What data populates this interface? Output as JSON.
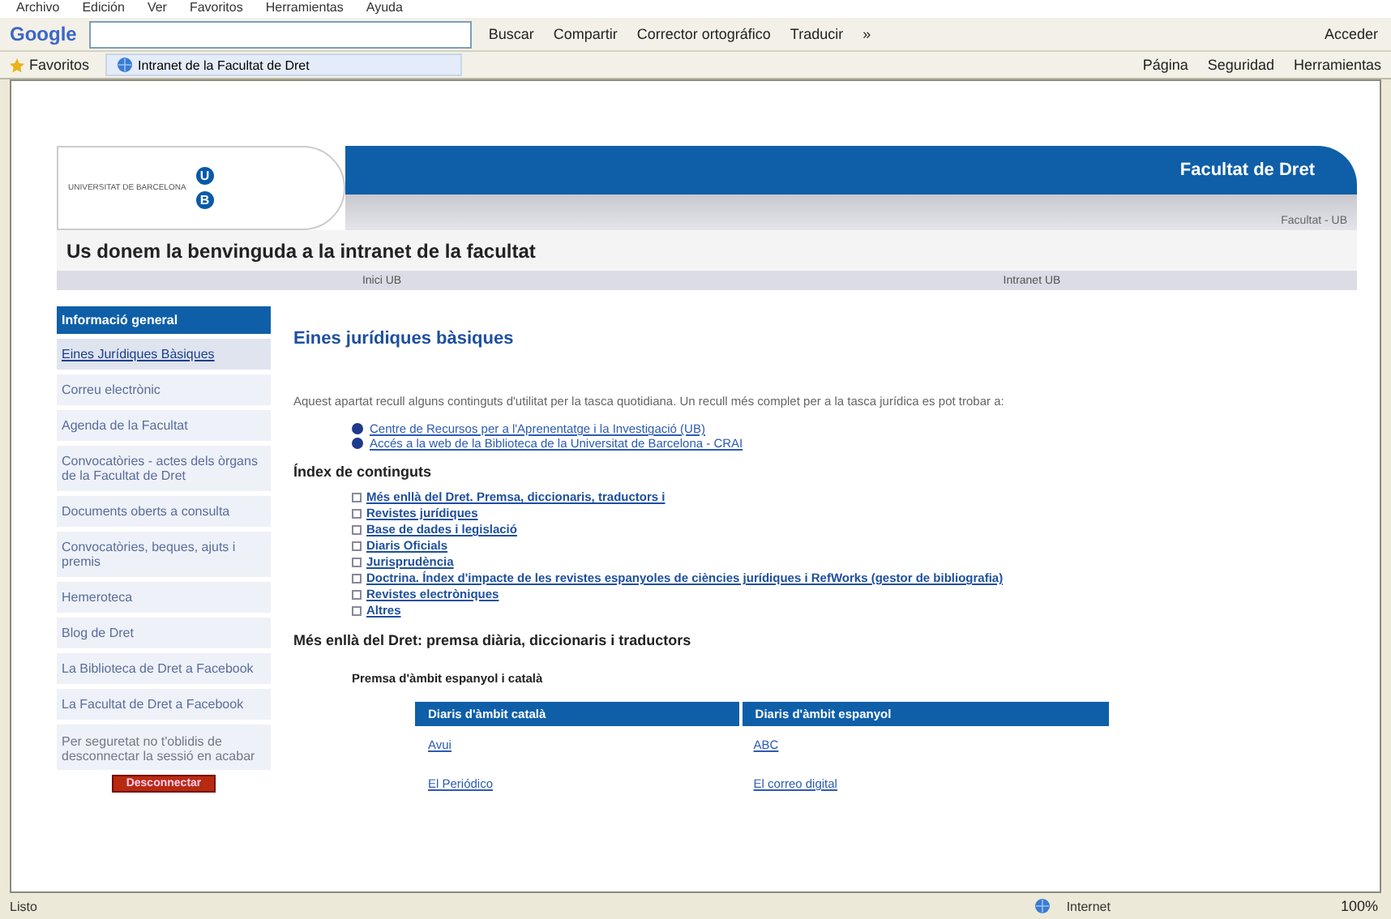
{
  "browser": {
    "menu": [
      "Archivo",
      "Edición",
      "Ver",
      "Favoritos",
      "Herramientas",
      "Ayuda"
    ],
    "google_toolbar": {
      "logo": "Google",
      "buttons": [
        "Buscar",
        "Compartir",
        "Corrector ortográfico",
        "Traducir",
        "»"
      ],
      "signin": "Acceder"
    },
    "favorites": "Favoritos",
    "tab": {
      "title": "Intranet de la Facultat de Dret",
      "selected": true
    },
    "command_bar": [
      "Página",
      "Seguridad",
      "Herramientas"
    ]
  },
  "header": {
    "university": "UNIVERSITAT DE BARCELONA",
    "logo_letters": [
      "U",
      "B"
    ],
    "faculty": "Facultat de Dret",
    "crumb": "Facultat - UB"
  },
  "welcome": "Us donem la benvinguda a la intranet de la facultat",
  "nav": [
    "Inici UB",
    "Intranet UB"
  ],
  "sidebar": {
    "header": "Informació general",
    "items": [
      {
        "label": "Eines Jurídiques Bàsiques",
        "selected": true
      },
      {
        "label": "Correu electrònic",
        "selected": false
      },
      {
        "label": "Agenda de la Facultat",
        "selected": false
      },
      {
        "label": "Convocatòries - actes dels òrgans de la Facultat de Dret",
        "selected": false
      },
      {
        "label": "Documents oberts a consulta",
        "selected": false
      },
      {
        "label": "Convocatòries, beques, ajuts i premis",
        "selected": false
      },
      {
        "label": "Hemeroteca",
        "selected": false
      },
      {
        "label": "Blog de Dret",
        "selected": false
      },
      {
        "label": "La Biblioteca de Dret a Facebook",
        "selected": false
      },
      {
        "label": "La Facultat de Dret a Facebook",
        "selected": false
      }
    ],
    "note": "Per seguretat no t'oblidis de desconnectar la sessió en acabar",
    "logout": "Desconnectar"
  },
  "content": {
    "title": "Eines jurídiques bàsiques",
    "intro": "Aquest apartat recull alguns continguts d'utilitat per la tasca quotidiana. Un recull més complet per a la tasca jurídica es pot trobar a:",
    "links": [
      "Centre de Recursos per a l'Aprenentatge i la Investigació (UB)",
      "Accés a la web de la Biblioteca de la Universitat de Barcelona - CRAI"
    ],
    "index_title": "Índex de continguts",
    "index": [
      "Més enllà del Dret. Premsa, diccionaris, traductors i",
      "Revistes jurídiques",
      "Base de dades i legislació",
      "Diaris Oficials",
      "Jurisprudència",
      "Doctrina. Índex d'impacte de les revistes espanyoles de ciències jurídiques i RefWorks (gestor de bibliografia)",
      "Revistes electròniques",
      "Altres"
    ],
    "section": "Més enllà del Dret: premsa diària, diccionaris i traductors",
    "subsection": "Premsa d'àmbit espanyol i català",
    "table": {
      "columns": [
        "Diaris d'àmbit català",
        "Diaris d'àmbit espanyol"
      ],
      "rows": [
        [
          "Avui",
          "ABC"
        ],
        [
          "El Periódico",
          "El correo digital"
        ]
      ]
    }
  },
  "status_bar": {
    "text": "Listo",
    "zone": "Internet",
    "zoom": "100%"
  }
}
